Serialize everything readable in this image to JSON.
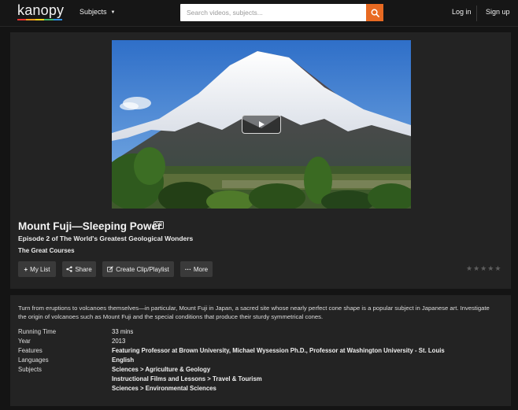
{
  "header": {
    "logo_text": "kanopy",
    "logo_colors": [
      "#e0322e",
      "#f39a1e",
      "#f2d21b",
      "#3db36b",
      "#2f8ee0"
    ],
    "subjects_label": "Subjects",
    "search_placeholder": "Search videos, subjects...",
    "login_label": "Log in",
    "signup_label": "Sign up"
  },
  "video": {
    "title": "Mount Fuji—Sleeping Power",
    "cc_label": "CC",
    "episode": "Episode 2 of The World's Greatest Geological Wonders",
    "publisher": "The Great Courses"
  },
  "actions": {
    "my_list": "My List",
    "share": "Share",
    "clip": "Create Clip/Playlist",
    "more": "More"
  },
  "rating": {
    "stars_total": 5,
    "stars_filled": 0
  },
  "description": "Turn from eruptions to volcanoes themselves—in particular, Mount Fuji in Japan, a sacred site whose nearly perfect cone shape is a popular subject in Japanese art. Investigate the origin of volcanoes such as Mount Fuji and the special conditions that produce their sturdy symmetrical cones.",
  "details": {
    "running_time_label": "Running Time",
    "running_time": "33 mins",
    "year_label": "Year",
    "year": "2013",
    "features_label": "Features",
    "features": "Featuring Professor at Brown University, Michael Wysession Ph.D., Professor at Washington University - St. Louis",
    "languages_label": "Languages",
    "languages": "English",
    "subjects_label": "Subjects",
    "subjects": [
      "Sciences > Agriculture & Geology",
      "Instructional Films and Lessons > Travel & Tourism",
      "Sciences > Environmental Sciences"
    ]
  },
  "colors": {
    "accent": "#e86a22",
    "background": "#141414",
    "panel": "#232323",
    "button": "#3a3a3a"
  }
}
